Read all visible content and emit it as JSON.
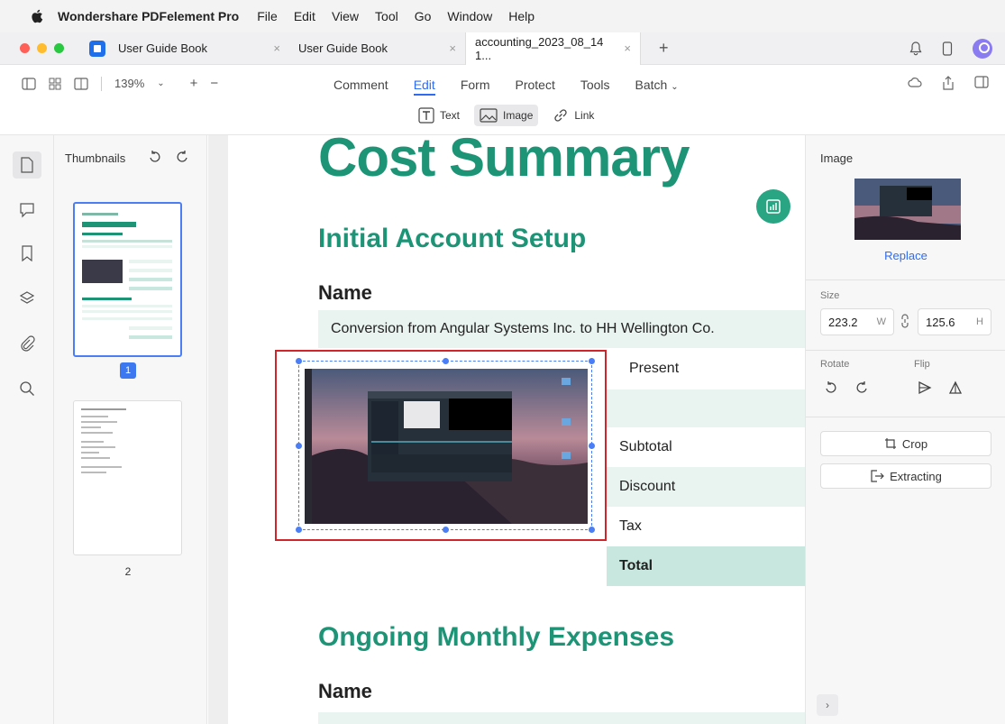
{
  "menubar": {
    "app_name": "Wondershare PDFelement Pro",
    "items": [
      "File",
      "Edit",
      "View",
      "Tool",
      "Go",
      "Window",
      "Help"
    ]
  },
  "tabs": [
    {
      "label": "User Guide Book",
      "close": "×"
    },
    {
      "label": "User Guide Book",
      "close": "×"
    },
    {
      "label": "accounting_2023_08_14 1...",
      "close": "×"
    }
  ],
  "toolbar": {
    "zoom": "139%",
    "zoom_in": "+",
    "zoom_out": "−",
    "modes": [
      "Comment",
      "Edit",
      "Form",
      "Protect",
      "Tools",
      "Batch"
    ],
    "active_mode": "Edit",
    "subtools": {
      "text": "Text",
      "image": "Image",
      "link": "Link"
    }
  },
  "thumbnails": {
    "title": "Thumbnails",
    "page1_badge": "1",
    "page2_label": "2"
  },
  "document": {
    "title": "Cost Summary",
    "section1": "Initial Account Setup",
    "name_heading": "Name",
    "row1": "Conversion from Angular Systems Inc. to HH Wellington Co.",
    "row2_tail": "Present",
    "summary": [
      "Subtotal",
      "Discount",
      "Tax",
      "Total"
    ],
    "section2": "Ongoing Monthly Expenses",
    "name_heading2": "Name"
  },
  "properties": {
    "title": "Image",
    "replace": "Replace",
    "size_label": "Size",
    "width": "223.2",
    "width_unit": "W",
    "height": "125.6",
    "height_unit": "H",
    "rotate_label": "Rotate",
    "flip_label": "Flip",
    "crop": "Crop",
    "extracting": "Extracting",
    "expand": "›"
  },
  "colors": {
    "accent": "#2f6bf0",
    "doc_green": "#1e9477",
    "selection_red": "#d0262b"
  }
}
